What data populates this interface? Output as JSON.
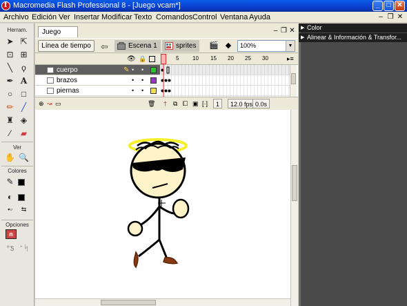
{
  "window": {
    "title": "Macromedia Flash Professional 8 - [Juego vcam*]",
    "icon_letter": "f",
    "minimize": "_",
    "maximize": "□",
    "close": "✕"
  },
  "menubar": {
    "items": [
      "Archivo",
      "Edición",
      "Ver",
      "Insertar",
      "Modificar",
      "Texto",
      "Comandos",
      "Control",
      "Ventana",
      "Ayuda"
    ],
    "doc_min": "–",
    "doc_restore": "❐",
    "doc_close": "✕"
  },
  "tools": {
    "header": "Herram.",
    "view_label": "Ver",
    "colors_label": "Colores",
    "options_label": "Opciones",
    "stroke_color": "#000000",
    "fill_color": "#000000"
  },
  "document": {
    "tab_label": "Juego vcam*",
    "timeline_button": "Línea de tiempo",
    "scene_label": "Escena 1",
    "symbol_label": "sprites",
    "zoom": "100%"
  },
  "timeline": {
    "frame_numbers": [
      "5",
      "10",
      "15",
      "20",
      "25",
      "30"
    ],
    "layers": [
      {
        "name": "cuerpo",
        "color": "#22cc22",
        "active": true
      },
      {
        "name": "brazos",
        "color": "#9933cc",
        "active": false
      },
      {
        "name": "piernas",
        "color": "#f0e050",
        "active": false
      }
    ],
    "current_frame": "1",
    "fps": "12.0 fps",
    "elapsed": "0.0s"
  },
  "panels": {
    "color": "Color",
    "align_info": "Alinear & Información & Transfor..."
  }
}
